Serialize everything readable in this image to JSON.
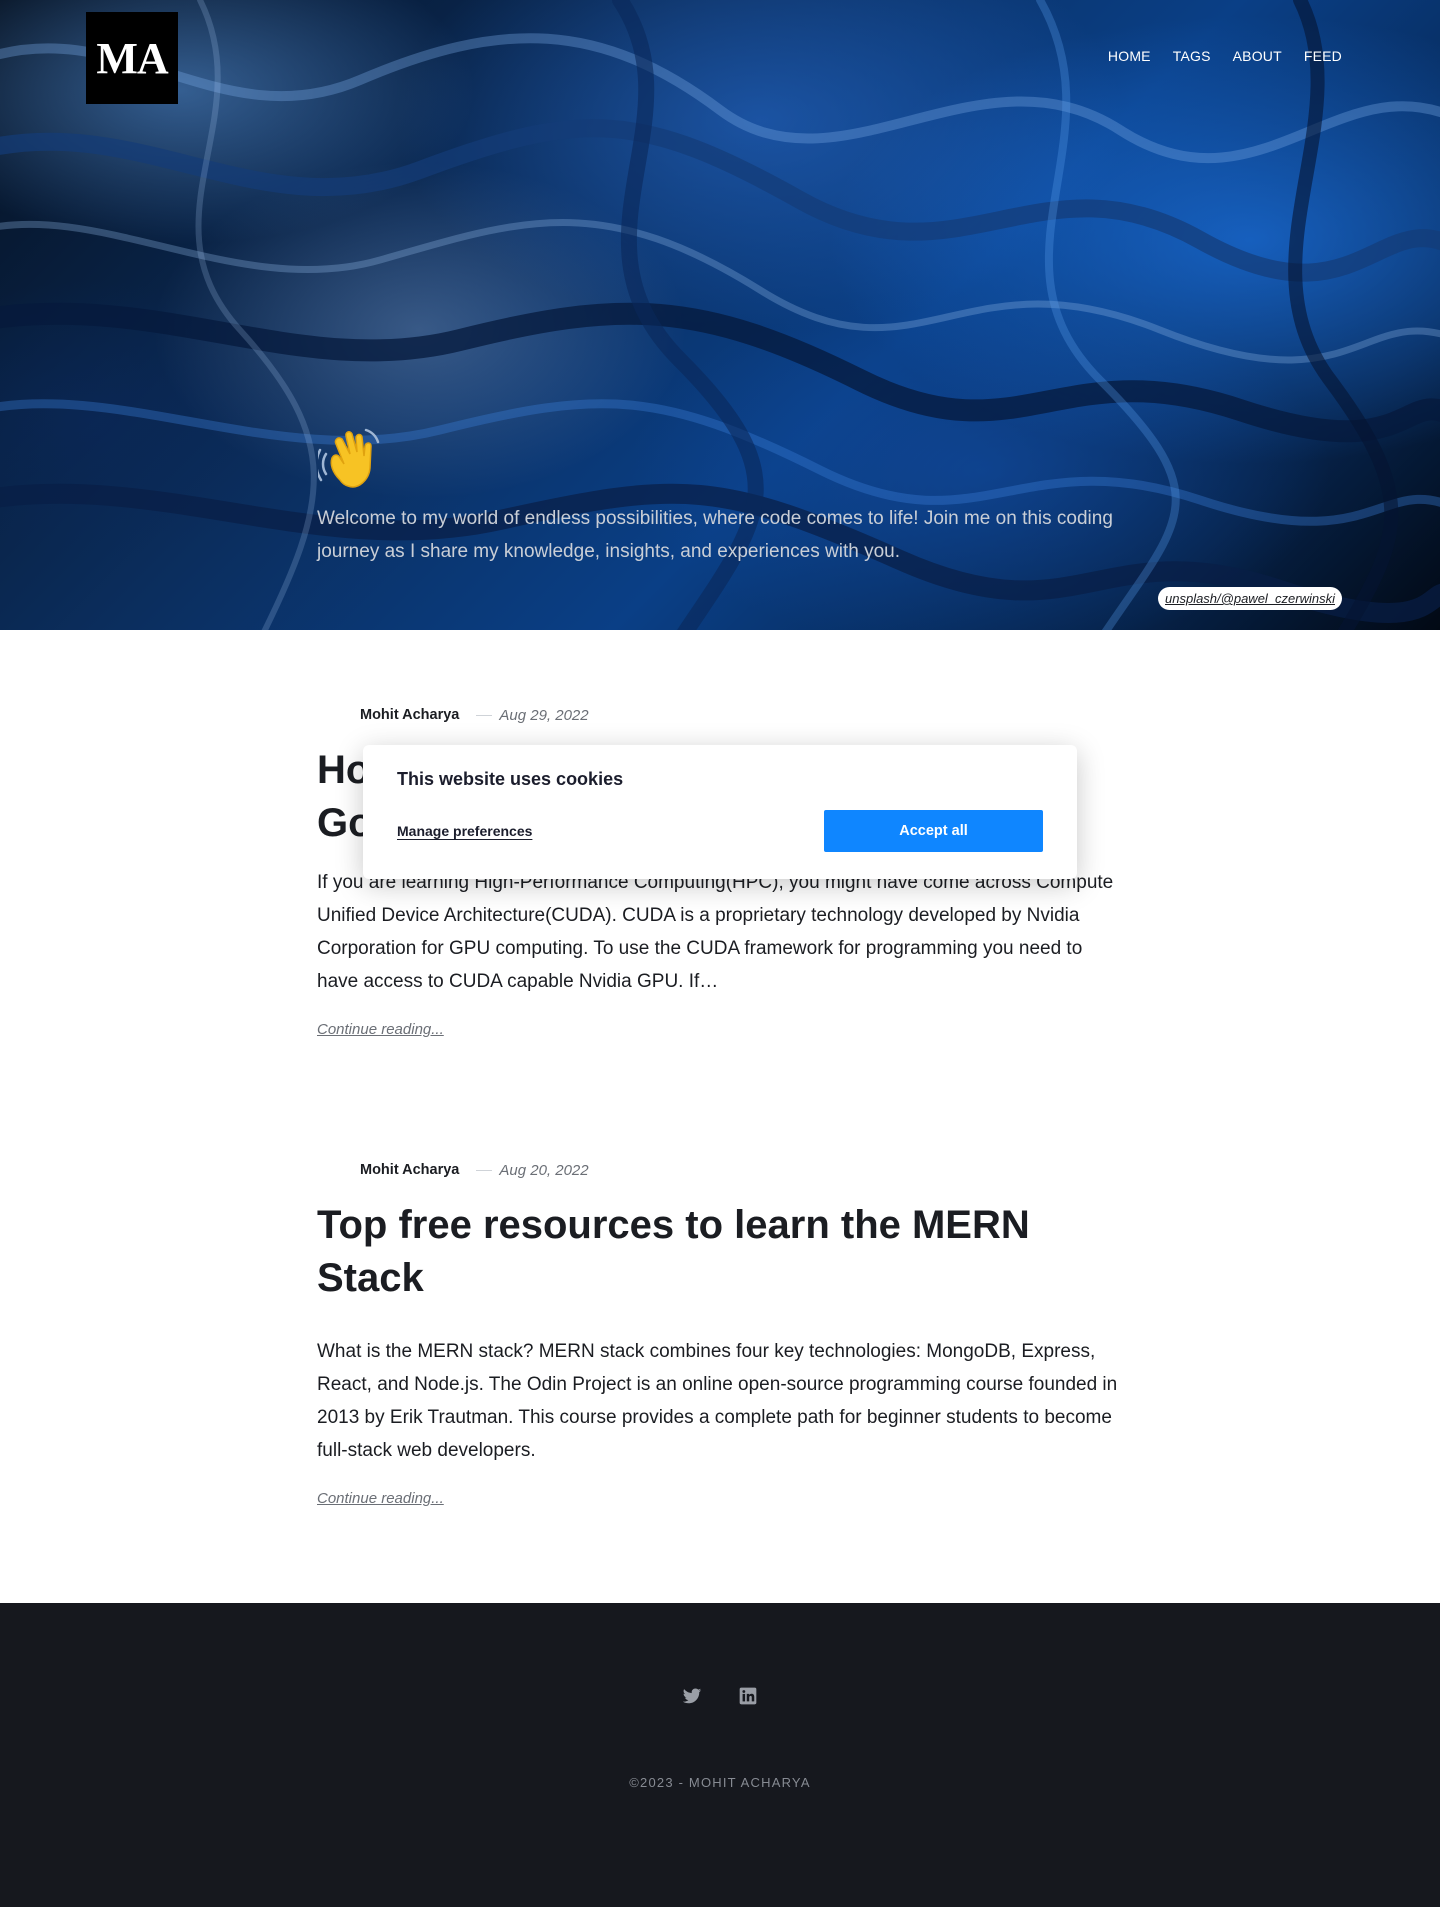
{
  "header": {
    "logo_text": "MA",
    "nav": [
      {
        "label": "HOME"
      },
      {
        "label": "TAGS"
      },
      {
        "label": "ABOUT"
      },
      {
        "label": "FEED"
      }
    ],
    "hero_emoji": "waving-hand-icon",
    "tagline": "Welcome to my world of endless possibilities, where code comes to life! Join me on this coding journey as I share my knowledge, insights, and experiences with you.",
    "image_credit": "unsplash/@pawel_czerwinski"
  },
  "posts": [
    {
      "author": "Mohit Acharya",
      "date": "Aug 29, 2022",
      "title": "Ho… Go…",
      "title_visible_line1": "Ho",
      "title_visible_line2": "Go",
      "excerpt": "If you are learning High-Performance Computing(HPC), you might have come across Compute Unified Device Architecture(CUDA). CUDA is a proprietary technology developed by Nvidia Corporation for GPU computing. To use the CUDA framework for programming you need to have access to CUDA capable Nvidia GPU. If…",
      "continue_label": "Continue reading..."
    },
    {
      "author": "Mohit Acharya",
      "date": "Aug 20, 2022",
      "title": "Top free resources to learn the MERN Stack",
      "excerpt": "What is the MERN stack? MERN stack combines four key technologies: MongoDB, Express, React, and Node.js. The Odin Project is an online open-source programming course founded in 2013 by Erik Trautman. This course provides a complete path for beginner students to become full-stack web developers.",
      "continue_label": "Continue reading..."
    }
  ],
  "cookie_banner": {
    "title": "This website uses cookies",
    "manage_label": "Manage preferences",
    "accept_label": "Accept all",
    "accept_color": "#0f86ff"
  },
  "footer": {
    "socials": [
      "twitter-icon",
      "linkedin-icon"
    ],
    "copyright": "©2023 - MOHIT ACHARYA"
  },
  "colors": {
    "footer_bg": "#16181e",
    "hero_base": "#0a3f86"
  }
}
